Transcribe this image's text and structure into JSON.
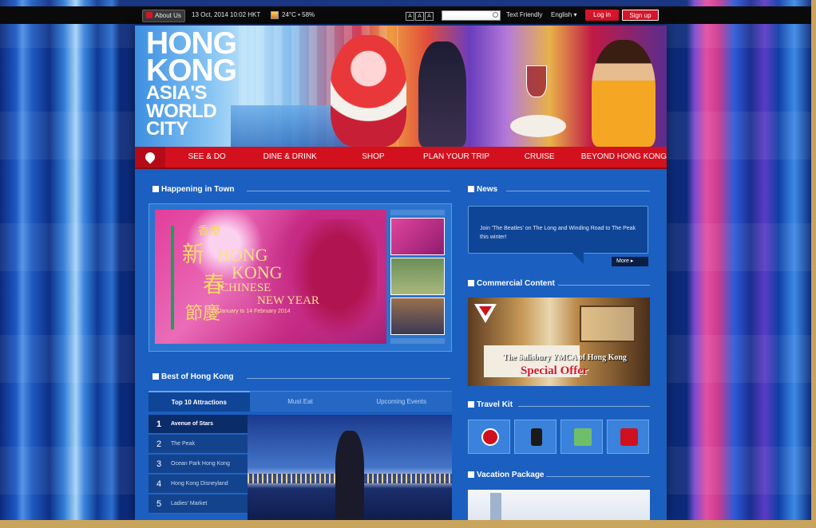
{
  "topbar": {
    "about": "About Us",
    "date": "13 Oct, 2014 10:02 HKT",
    "weather": "24°C • 58%",
    "font_sizes": [
      "A",
      "A",
      "A"
    ],
    "text_friendly": "Text Friendly",
    "language": "English ▾",
    "login": "Log in",
    "signup": "Sign up"
  },
  "banner": {
    "title_lines": [
      "HONG",
      "KONG",
      "ASIA'S",
      "WORLD",
      "CITY"
    ]
  },
  "nav": {
    "items": [
      "SEE & DO",
      "DINE & DRINK",
      "SHOP",
      "PLAN YOUR TRIP",
      "CRUISE",
      "BEYOND HONG KONG"
    ]
  },
  "happening": {
    "heading": "Happening in Town",
    "hero": {
      "cn_small": "香港",
      "cn_chars": [
        "新",
        "春",
        "節慶"
      ],
      "en_lines": [
        "HONG",
        "KONG",
        "CHINESE",
        "NEW YEAR"
      ],
      "dates": "25 January to 14 February 2014"
    }
  },
  "best": {
    "heading": "Best of Hong Kong",
    "tabs": [
      "Top 10 Attractions",
      "Must Eat",
      "Upcoming Events"
    ],
    "attractions": [
      {
        "num": "1",
        "name": "Avenue of Stars"
      },
      {
        "num": "2",
        "name": "The Peak"
      },
      {
        "num": "3",
        "name": "Ocean Park Hong Kong"
      },
      {
        "num": "4",
        "name": "Hong Kong Disneyland"
      },
      {
        "num": "5",
        "name": "Ladies' Market"
      }
    ]
  },
  "news": {
    "heading": "News",
    "text": "Join 'The Beatles' on The Long and Winding Road to The Peak this winter!",
    "more": "More"
  },
  "commercial": {
    "heading": "Commercial Content",
    "ad_line1": "The Salisbury YMCA of Hong Kong",
    "ad_line2": "Special Offer"
  },
  "travel_kit": {
    "heading": "Travel Kit"
  },
  "vacation": {
    "heading": "Vacation Package"
  }
}
